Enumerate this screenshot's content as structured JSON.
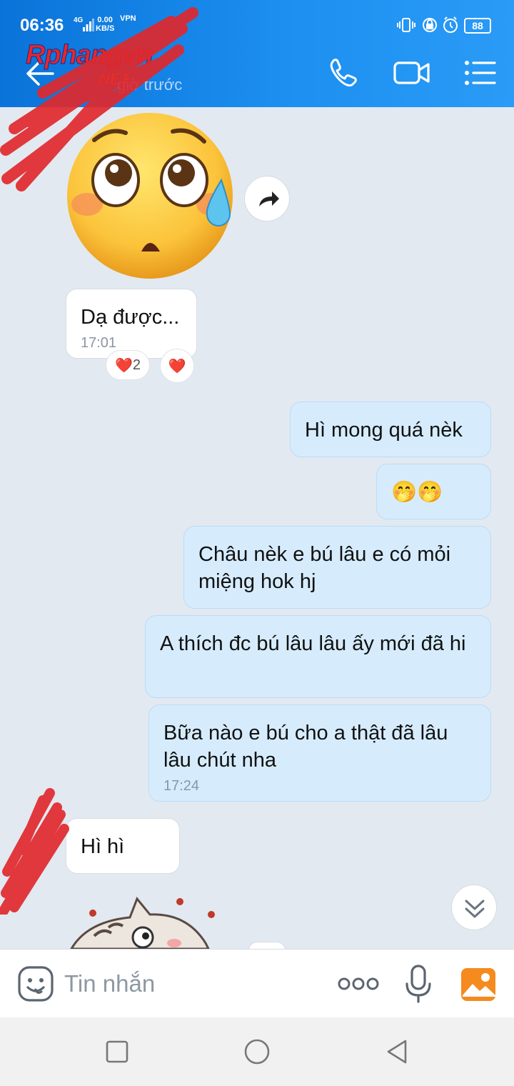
{
  "status_bar": {
    "time": "06:36",
    "network": "4G",
    "speed_value": "0.00",
    "speed_unit": "KB/S",
    "vpn": "VPN",
    "battery": "88"
  },
  "header": {
    "brand_name": "Rphangvn",
    "brand_tld": ".NET",
    "last_seen": "giờ trước",
    "icons": [
      "back-arrow-icon",
      "phone-icon",
      "video-camera-icon",
      "menu-list-icon"
    ],
    "accent_color": "#1a88ec"
  },
  "messages": [
    {
      "side": "incoming",
      "type": "sticker",
      "sticker": "anxious-face-sweat-emoji"
    },
    {
      "side": "incoming",
      "type": "text",
      "text": "Dạ được...",
      "time": "17:01",
      "reactions": [
        {
          "emoji": "❤️",
          "count": "2"
        },
        {
          "emoji": "❤️"
        }
      ]
    },
    {
      "side": "outgoing",
      "type": "text",
      "text": "Hì mong quá nèk"
    },
    {
      "side": "outgoing",
      "type": "emoji",
      "text": "🤭🤭"
    },
    {
      "side": "outgoing",
      "type": "text",
      "text": "Châu nèk e bú lâu e có mỏi miệng hok hj"
    },
    {
      "side": "outgoing",
      "type": "text",
      "text": "A thích đc bú lâu lâu ấy mới đã hi"
    },
    {
      "side": "outgoing",
      "type": "text",
      "text": "Bữa nào e bú cho a thật đã lâu lâu chút nha",
      "time": "17:24"
    },
    {
      "side": "incoming",
      "type": "text",
      "text": "Hì hì"
    },
    {
      "side": "incoming",
      "type": "sticker",
      "sticker": "cat-sticker"
    }
  ],
  "composer": {
    "placeholder": "Tin nhắn",
    "value": "",
    "icons": [
      "emoji-icon",
      "more-dots-icon",
      "microphone-icon",
      "photo-icon"
    ],
    "photo_color": "#f58a1f"
  },
  "nav": {
    "icons": [
      "recent-apps-icon",
      "home-icon",
      "back-triangle-icon"
    ]
  }
}
